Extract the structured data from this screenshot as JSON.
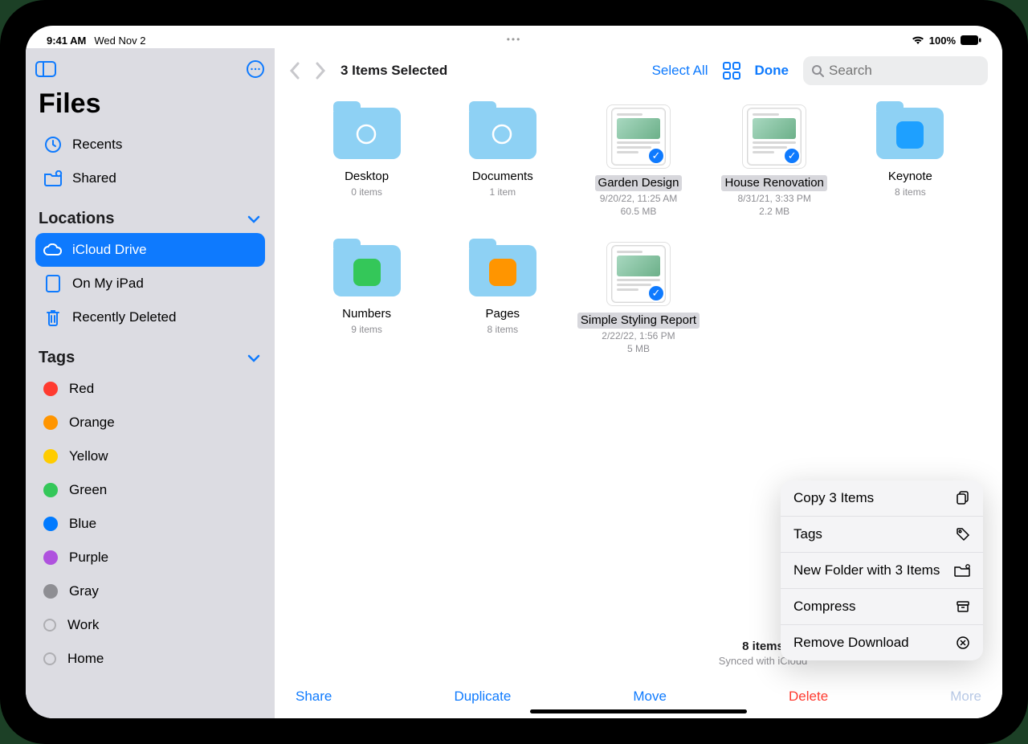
{
  "statusbar": {
    "time": "9:41 AM",
    "date": "Wed Nov 2",
    "battery": "100%"
  },
  "sidebar": {
    "title": "Files",
    "recents": "Recents",
    "shared": "Shared",
    "locations_header": "Locations",
    "locations": [
      {
        "label": "iCloud Drive"
      },
      {
        "label": "On My iPad"
      },
      {
        "label": "Recently Deleted"
      }
    ],
    "tags_header": "Tags",
    "tags": [
      {
        "label": "Red",
        "color": "#ff3b30"
      },
      {
        "label": "Orange",
        "color": "#ff9500"
      },
      {
        "label": "Yellow",
        "color": "#ffcc00"
      },
      {
        "label": "Green",
        "color": "#34c759"
      },
      {
        "label": "Blue",
        "color": "#007aff"
      },
      {
        "label": "Purple",
        "color": "#af52de"
      },
      {
        "label": "Gray",
        "color": "#8e8e93"
      },
      {
        "label": "Work",
        "ring": true
      },
      {
        "label": "Home",
        "ring": true
      }
    ]
  },
  "toolbar": {
    "selection_title": "3 Items Selected",
    "select_all": "Select All",
    "done": "Done",
    "search_placeholder": "Search"
  },
  "items": [
    {
      "name": "Desktop",
      "sub": "0 items",
      "kind": "folder"
    },
    {
      "name": "Documents",
      "sub": "1 item",
      "kind": "folder"
    },
    {
      "name": "Garden Design",
      "sub": "9/20/22, 11:25 AM",
      "sub2": "60.5 MB",
      "kind": "doc",
      "selected": true
    },
    {
      "name": "House Renovation",
      "sub": "8/31/21, 3:33 PM",
      "sub2": "2.2 MB",
      "kind": "doc",
      "selected": true,
      "multiline": true
    },
    {
      "name": "Keynote",
      "sub": "8 items",
      "kind": "appfolder",
      "app_color": "#1ea0ff"
    },
    {
      "name": "Numbers",
      "sub": "9 items",
      "kind": "appfolder",
      "app_color": "#34c759"
    },
    {
      "name": "Pages",
      "sub": "8 items",
      "kind": "appfolder",
      "app_color": "#ff9500"
    },
    {
      "name": "Simple Styling Report",
      "sub": "2/22/22, 1:56 PM",
      "sub2": "5 MB",
      "kind": "doc",
      "selected": true,
      "multiline": true
    }
  ],
  "footer": {
    "count": "8 items",
    "sync": "Synced with iCloud"
  },
  "actions": {
    "share": "Share",
    "duplicate": "Duplicate",
    "move": "Move",
    "delete": "Delete",
    "more": "More"
  },
  "popup": [
    {
      "label": "Copy 3 Items"
    },
    {
      "label": "Tags"
    },
    {
      "label": "New Folder with 3 Items"
    },
    {
      "label": "Compress"
    },
    {
      "label": "Remove Download"
    }
  ]
}
